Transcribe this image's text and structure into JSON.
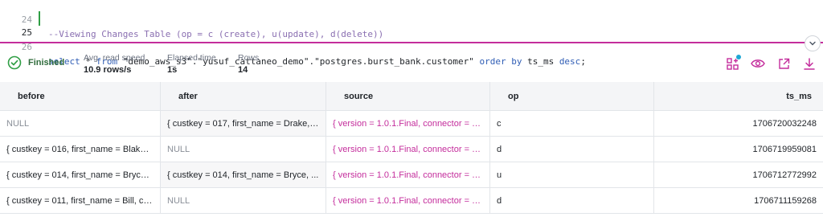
{
  "editor": {
    "lines": [
      {
        "no": "24",
        "text": "--Viewing Changes Table (op = c (create), u(update), d(delete))"
      },
      {
        "no": "25",
        "kw1": "select",
        "mid1": " * ",
        "kw2": "from",
        "mid2": " \"demo_aws_s3\".\"yusuf_cattaneo_demo\".\"postgres.burst_bank.customer\" ",
        "kw3": "order by",
        "mid3": " ts_ms ",
        "kw4": "desc",
        "end": ";"
      },
      {
        "no": "26",
        "text": ""
      }
    ]
  },
  "status": {
    "state": "Finished",
    "state_color": "#2f9e44",
    "stats": [
      {
        "key": "Avg. read speed",
        "value": "10.9 rows/s"
      },
      {
        "key": "Elapsed time",
        "value": "1s"
      },
      {
        "key": "Rows",
        "value": "14"
      }
    ],
    "tools": [
      "grid-icon",
      "eye-icon",
      "external-link-icon",
      "download-icon"
    ],
    "accent": "#c42d9c"
  },
  "table": {
    "columns": [
      "before",
      "after",
      "source",
      "op",
      "ts_ms"
    ],
    "rows": [
      {
        "before": "NULL",
        "after": "{ custkey = 017, first_name = Drake, ...",
        "source": "{ version = 1.0.1.Final, connector = p...",
        "op": "c",
        "ts_ms": "1706720032248"
      },
      {
        "before": "{ custkey = 016, first_name = Blake, ...",
        "after": "NULL",
        "source": "{ version = 1.0.1.Final, connector = p...",
        "op": "d",
        "ts_ms": "1706719959081"
      },
      {
        "before": "{ custkey = 014, first_name = Bryce,...",
        "after": "{ custkey = 014, first_name = Bryce, ...",
        "source": "{ version = 1.0.1.Final, connector = p...",
        "op": "u",
        "ts_ms": "1706712772992"
      },
      {
        "before": "{ custkey = 011, first_name = Bill, cit...",
        "after": "NULL",
        "source": "{ version = 1.0.1.Final, connector = p...",
        "op": "d",
        "ts_ms": "1706711159268"
      }
    ]
  }
}
